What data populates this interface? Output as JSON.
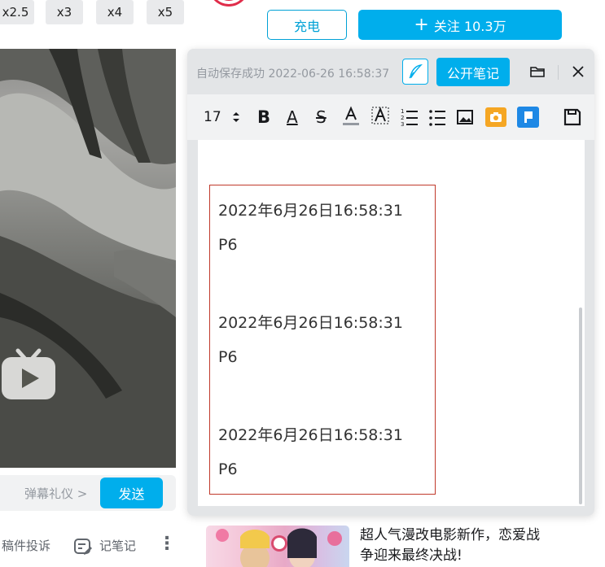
{
  "speed_options": [
    "x2.5",
    "x3",
    "x4",
    "x5"
  ],
  "header": {
    "charge_label": "充电",
    "follow_label": "关注 10.3万",
    "follow_plus": "+"
  },
  "player": {
    "danmu_etiquette": "弹幕礼仪 >",
    "send_label": "发送"
  },
  "bottom_actions": {
    "report_label": "稿件投诉",
    "note_label": "记笔记",
    "more": "⋮"
  },
  "note_panel": {
    "autosave_text": "自动保存成功  2022-06-26 16:58:37",
    "public_note_label": "公开笔记",
    "toolbar": {
      "font_size": "17",
      "bold": "B",
      "color": "A",
      "strike": "S"
    },
    "entries": [
      {
        "timestamp": "2022年6月26日16:58:31",
        "page": "P6"
      },
      {
        "timestamp": "2022年6月26日16:58:31",
        "page": "P6"
      },
      {
        "timestamp": "2022年6月26日16:58:31",
        "page": "P6"
      }
    ]
  },
  "recommendation": {
    "title_line1": "超人气漫改电影新作，恋爱战",
    "title_line2": "争迎来最终决战!"
  },
  "colors": {
    "accent": "#00aeec",
    "quote_border": "#c0392b",
    "camera_icon": "#f5a623",
    "flag_icon": "#1e88e5"
  }
}
